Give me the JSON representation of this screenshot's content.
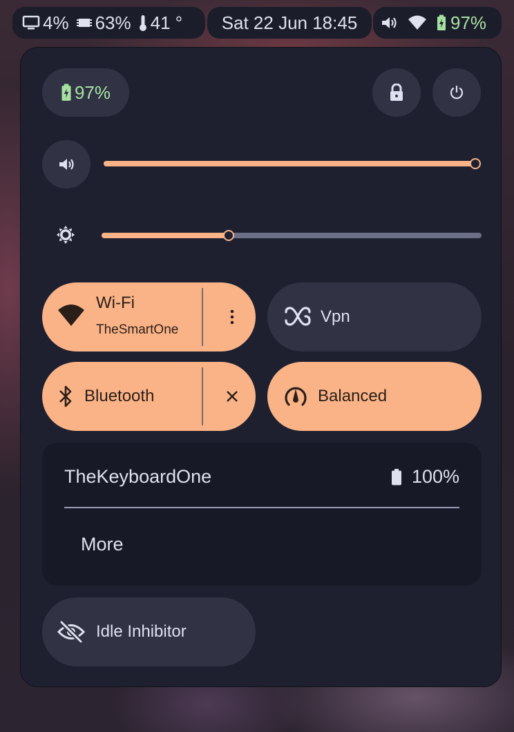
{
  "topbar": {
    "screen_value": "4%",
    "cpu_value": "63%",
    "temp_value": "41 °",
    "datetime": "Sat 22 Jun 18:45",
    "battery_value": "97%"
  },
  "panel": {
    "battery_label": "97%",
    "volume": {
      "level": 1.0
    },
    "brightness": {
      "level": 0.335
    },
    "tiles": {
      "wifi": {
        "label": "Wi-Fi",
        "network": "TheSmartOne",
        "state": "on"
      },
      "vpn": {
        "label": "Vpn",
        "state": "off"
      },
      "bluetooth": {
        "label": "Bluetooth",
        "state": "on"
      },
      "power_profile": {
        "label": "Balanced",
        "state": "on"
      },
      "idle_inhibitor": {
        "label": "Idle Inhibitor",
        "state": "off"
      }
    },
    "bluetooth_device": {
      "name": "TheKeyboardOne",
      "battery": "100%",
      "more_label": "More"
    }
  },
  "colors": {
    "accent": "#fab387",
    "panel_bg": "#1e2030",
    "tile_off": "#313244",
    "battery_green": "#a6e3a1"
  },
  "icons": [
    "monitor-icon",
    "cpu-icon",
    "thermometer-icon",
    "volume-icon",
    "wifi-icon",
    "battery-charging-icon",
    "lock-icon",
    "power-icon",
    "brightness-icon",
    "more-vertical-icon",
    "vpn-icon",
    "bluetooth-icon",
    "close-icon",
    "gauge-icon",
    "battery-icon",
    "eye-off-icon"
  ]
}
